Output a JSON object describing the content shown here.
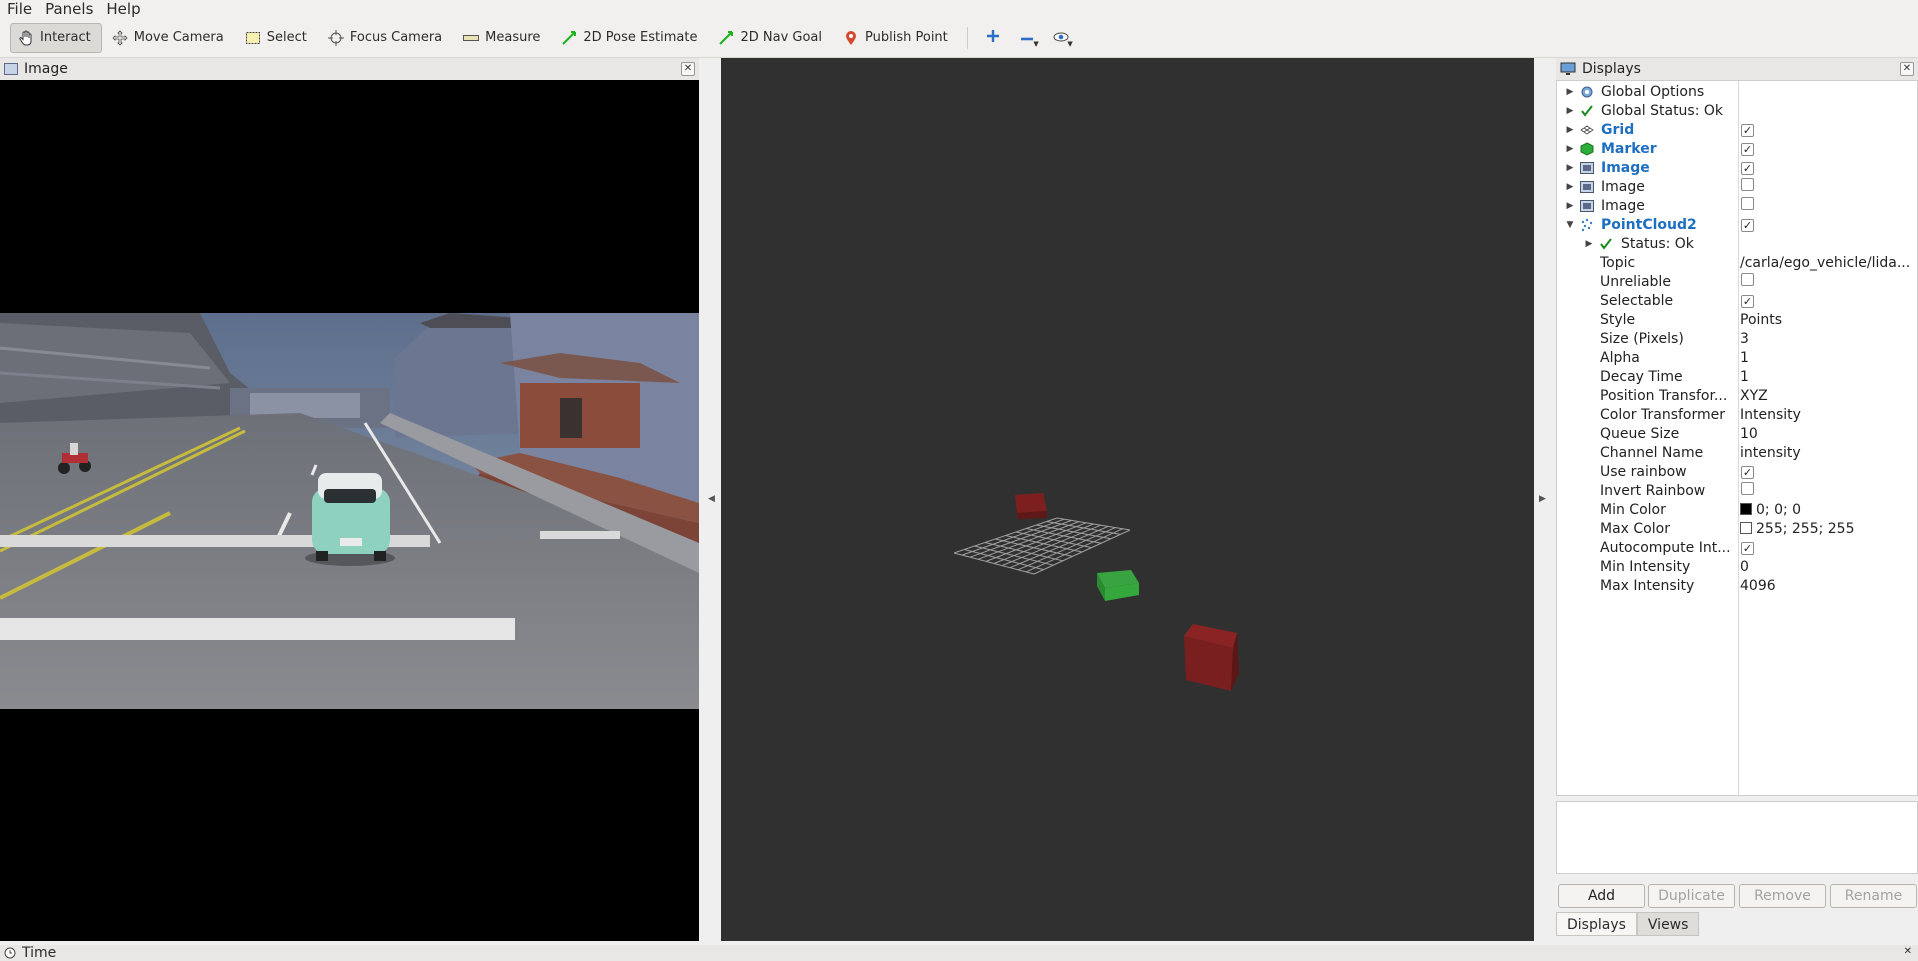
{
  "menu": {
    "items": [
      {
        "label": "File"
      },
      {
        "label": "Panels"
      },
      {
        "label": "Help"
      }
    ]
  },
  "toolbar": {
    "tools": [
      {
        "label": "Interact",
        "icon": "hand-icon",
        "active": true
      },
      {
        "label": "Move Camera",
        "icon": "move-camera-icon"
      },
      {
        "label": "Select",
        "icon": "select-box-icon"
      },
      {
        "label": "Focus Camera",
        "icon": "crosshair-icon"
      },
      {
        "label": "Measure",
        "icon": "ruler-icon"
      },
      {
        "label": "2D Pose Estimate",
        "icon": "green-arrow-icon"
      },
      {
        "label": "2D Nav Goal",
        "icon": "green-arrow-icon"
      },
      {
        "label": "Publish Point",
        "icon": "map-pin-icon"
      }
    ],
    "extra_icons": [
      "add-tool-icon",
      "remove-tool-icon",
      "camera-view-icon"
    ]
  },
  "image_panel": {
    "title": "Image"
  },
  "displays_panel": {
    "title": "Displays",
    "rows": [
      {
        "label": "Global Options",
        "icon": "gear-icon",
        "value": "",
        "checkbox": null,
        "bold": false
      },
      {
        "label": "Global Status: Ok",
        "icon": "check-icon",
        "value": "",
        "checkbox": null,
        "bold": false
      },
      {
        "label": "Grid",
        "icon": "grid-icon",
        "value": "",
        "checkbox": true,
        "bold": true
      },
      {
        "label": "Marker",
        "icon": "marker-cube-icon",
        "value": "",
        "checkbox": true,
        "bold": true
      },
      {
        "label": "Image",
        "icon": "image-icon",
        "value": "",
        "checkbox": true,
        "bold": true
      },
      {
        "label": "Image",
        "icon": "image-icon",
        "value": "",
        "checkbox": false,
        "bold": false
      },
      {
        "label": "Image",
        "icon": "image-icon",
        "value": "",
        "checkbox": false,
        "bold": false
      },
      {
        "label": "PointCloud2",
        "icon": "pointcloud-icon",
        "value": "",
        "checkbox": true,
        "bold": true,
        "expanded": true
      }
    ],
    "pointcloud_props": [
      {
        "label": "Status: Ok",
        "icon": "check-icon",
        "value": "",
        "checkbox": null
      },
      {
        "label": "Topic",
        "value": "/carla/ego_vehicle/lida...",
        "checkbox": null
      },
      {
        "label": "Unreliable",
        "value": "",
        "checkbox": false
      },
      {
        "label": "Selectable",
        "value": "",
        "checkbox": true
      },
      {
        "label": "Style",
        "value": "Points",
        "checkbox": null
      },
      {
        "label": "Size (Pixels)",
        "value": "3",
        "checkbox": null
      },
      {
        "label": "Alpha",
        "value": "1",
        "checkbox": null
      },
      {
        "label": "Decay Time",
        "value": "1",
        "checkbox": null
      },
      {
        "label": "Position Transfor...",
        "value": "XYZ",
        "checkbox": null
      },
      {
        "label": "Color Transformer",
        "value": "Intensity",
        "checkbox": null
      },
      {
        "label": "Queue Size",
        "value": "10",
        "checkbox": null
      },
      {
        "label": "Channel Name",
        "value": "intensity",
        "checkbox": null
      },
      {
        "label": "Use rainbow",
        "value": "",
        "checkbox": true
      },
      {
        "label": "Invert Rainbow",
        "value": "",
        "checkbox": false
      },
      {
        "label": "Min Color",
        "value": "0; 0; 0",
        "swatch": "#000000",
        "checkbox": null
      },
      {
        "label": "Max Color",
        "value": "255; 255; 255",
        "swatch": "#ffffff",
        "checkbox": null
      },
      {
        "label": "Autocompute Int...",
        "value": "",
        "checkbox": true
      },
      {
        "label": "Min Intensity",
        "value": "0",
        "checkbox": null
      },
      {
        "label": "Max Intensity",
        "value": "4096",
        "checkbox": null
      }
    ],
    "buttons": [
      {
        "label": "Add",
        "enabled": true
      },
      {
        "label": "Duplicate",
        "enabled": false
      },
      {
        "label": "Remove",
        "enabled": false
      },
      {
        "label": "Rename",
        "enabled": false
      }
    ],
    "tabs": [
      {
        "label": "Displays",
        "active": true
      },
      {
        "label": "Views",
        "active": false
      }
    ]
  },
  "time_panel": {
    "title": "Time"
  },
  "colors": {
    "render_bg": "#303030",
    "marker_red": "#7a1f1f",
    "marker_green": "#2f9a36",
    "grid_line": "#a0a0a0",
    "link_blue": "#1e6fc2"
  }
}
